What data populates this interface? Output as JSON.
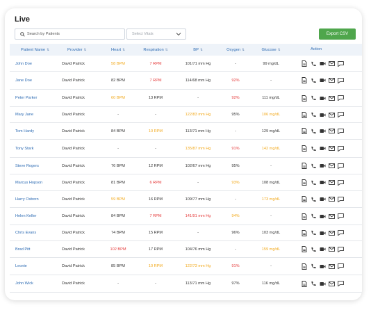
{
  "page": {
    "title": "Live"
  },
  "toolbar": {
    "search_placeholder": "Search by Patients",
    "vitals_select": "Select Vitals",
    "export_label": "Export CSV"
  },
  "columns": [
    {
      "label": "Patient Name",
      "sort": "⇅"
    },
    {
      "label": "Provider",
      "sort": "⇅"
    },
    {
      "label": "Heart",
      "sort": "⇅"
    },
    {
      "label": "Respiration",
      "sort": "⇅"
    },
    {
      "label": "BP",
      "sort": "⇅"
    },
    {
      "label": "Oxygen",
      "sort": "⇅"
    },
    {
      "label": "Glucose",
      "sort": "⇅"
    },
    {
      "label": "Action",
      "sort": ""
    }
  ],
  "status_colors": {
    "normal": "#333333",
    "warning": "#f2a91c",
    "critical": "#e53b3b",
    "link": "#2d6bb3"
  },
  "icons": [
    "document-icon",
    "phone-icon",
    "video-icon",
    "mail-icon",
    "chat-icon"
  ],
  "rows": [
    {
      "name": "John Doe",
      "provider": "David Patrick",
      "heart": {
        "v": "58 BPM",
        "s": "warning"
      },
      "resp": {
        "v": "7 RPM",
        "s": "critical"
      },
      "bp": {
        "v": "101/71 mm Hg",
        "s": "normal"
      },
      "oxygen": {
        "v": "-",
        "s": "normal"
      },
      "glucose": {
        "v": "99 mg/dL",
        "s": "normal"
      }
    },
    {
      "name": "Jane Doe",
      "provider": "David Patrick",
      "heart": {
        "v": "82 BPM",
        "s": "normal"
      },
      "resp": {
        "v": "7 RPM",
        "s": "critical"
      },
      "bp": {
        "v": "114/68 mm Hg",
        "s": "normal"
      },
      "oxygen": {
        "v": "92%",
        "s": "critical"
      },
      "glucose": {
        "v": "-",
        "s": "normal"
      }
    },
    {
      "name": "Peter Parker",
      "provider": "David Patrick",
      "heart": {
        "v": "60 BPM",
        "s": "warning"
      },
      "resp": {
        "v": "13 RPM",
        "s": "normal"
      },
      "bp": {
        "v": "-",
        "s": "normal"
      },
      "oxygen": {
        "v": "92%",
        "s": "critical"
      },
      "glucose": {
        "v": "111 mg/dL",
        "s": "normal"
      }
    },
    {
      "name": "Mary Jane",
      "provider": "David Patrick",
      "heart": {
        "v": "-",
        "s": "normal"
      },
      "resp": {
        "v": "-",
        "s": "normal"
      },
      "bp": {
        "v": "122/83 mm Hg",
        "s": "warning"
      },
      "oxygen": {
        "v": "95%",
        "s": "normal"
      },
      "glucose": {
        "v": "106 mg/dL",
        "s": "warning"
      }
    },
    {
      "name": "Tom Hardy",
      "provider": "David Patrick",
      "heart": {
        "v": "84 BPM",
        "s": "normal"
      },
      "resp": {
        "v": "10 RPM",
        "s": "warning"
      },
      "bp": {
        "v": "113/71 mm Hg",
        "s": "normal"
      },
      "oxygen": {
        "v": "-",
        "s": "normal"
      },
      "glucose": {
        "v": "129 mg/dL",
        "s": "normal"
      }
    },
    {
      "name": "Tony Stark",
      "provider": "David Patrick",
      "heart": {
        "v": "-",
        "s": "normal"
      },
      "resp": {
        "v": "-",
        "s": "normal"
      },
      "bp": {
        "v": "135/87 mm Hg",
        "s": "warning"
      },
      "oxygen": {
        "v": "91%",
        "s": "critical"
      },
      "glucose": {
        "v": "142 mg/dL",
        "s": "warning"
      }
    },
    {
      "name": "Steve Rogers",
      "provider": "David Patrick",
      "heart": {
        "v": "76 BPM",
        "s": "normal"
      },
      "resp": {
        "v": "12 RPM",
        "s": "normal"
      },
      "bp": {
        "v": "102/67 mm Hg",
        "s": "normal"
      },
      "oxygen": {
        "v": "95%",
        "s": "normal"
      },
      "glucose": {
        "v": "-",
        "s": "normal"
      }
    },
    {
      "name": "Marcus Hopson",
      "provider": "David Patrick",
      "heart": {
        "v": "81 BPM",
        "s": "normal"
      },
      "resp": {
        "v": "6 RPM",
        "s": "critical"
      },
      "bp": {
        "v": "-",
        "s": "normal"
      },
      "oxygen": {
        "v": "93%",
        "s": "warning"
      },
      "glucose": {
        "v": "108 mg/dL",
        "s": "normal"
      }
    },
    {
      "name": "Harry Osborn",
      "provider": "David Patrick",
      "heart": {
        "v": "59 BPM",
        "s": "warning"
      },
      "resp": {
        "v": "16 RPM",
        "s": "normal"
      },
      "bp": {
        "v": "109/77 mm Hg",
        "s": "normal"
      },
      "oxygen": {
        "v": "-",
        "s": "normal"
      },
      "glucose": {
        "v": "173 mg/dL",
        "s": "warning"
      }
    },
    {
      "name": "Helen Keller",
      "provider": "David Patrick",
      "heart": {
        "v": "84 BPM",
        "s": "normal"
      },
      "resp": {
        "v": "7 RPM",
        "s": "critical"
      },
      "bp": {
        "v": "141/91 mm Hg",
        "s": "critical"
      },
      "oxygen": {
        "v": "94%",
        "s": "warning"
      },
      "glucose": {
        "v": "-",
        "s": "normal"
      }
    },
    {
      "name": "Chris Evans",
      "provider": "David Patrick",
      "heart": {
        "v": "74 BPM",
        "s": "normal"
      },
      "resp": {
        "v": "15 RPM",
        "s": "normal"
      },
      "bp": {
        "v": "-",
        "s": "normal"
      },
      "oxygen": {
        "v": "96%",
        "s": "normal"
      },
      "glucose": {
        "v": "103 mg/dL",
        "s": "normal"
      }
    },
    {
      "name": "Brad Pitt",
      "provider": "David Patrick",
      "heart": {
        "v": "102 BPM",
        "s": "critical"
      },
      "resp": {
        "v": "17 RPM",
        "s": "normal"
      },
      "bp": {
        "v": "104/76 mm Hg",
        "s": "normal"
      },
      "oxygen": {
        "v": "-",
        "s": "normal"
      },
      "glucose": {
        "v": "159 mg/dL",
        "s": "warning"
      }
    },
    {
      "name": "Leonie",
      "provider": "David Patrick",
      "heart": {
        "v": "85 BPM",
        "s": "normal"
      },
      "resp": {
        "v": "10 RPM",
        "s": "warning"
      },
      "bp": {
        "v": "122/73 mm Hg",
        "s": "warning"
      },
      "oxygen": {
        "v": "91%",
        "s": "critical"
      },
      "glucose": {
        "v": "-",
        "s": "normal"
      }
    },
    {
      "name": "John Wick",
      "provider": "David Patrick",
      "heart": {
        "v": "-",
        "s": "normal"
      },
      "resp": {
        "v": "-",
        "s": "normal"
      },
      "bp": {
        "v": "113/71 mm Hg",
        "s": "normal"
      },
      "oxygen": {
        "v": "97%",
        "s": "normal"
      },
      "glucose": {
        "v": "116 mg/dL",
        "s": "normal"
      }
    }
  ]
}
